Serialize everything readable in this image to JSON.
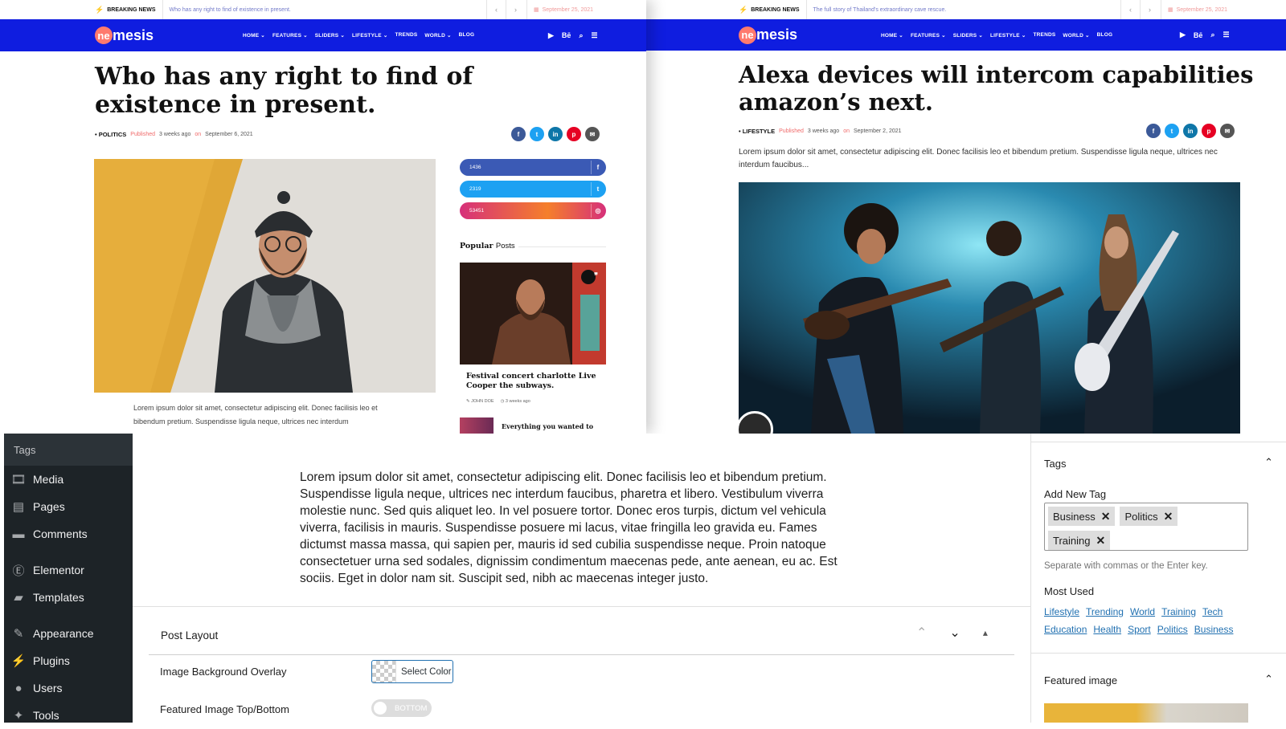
{
  "left_post": {
    "topbar": {
      "breaking_label": "BREAKING NEWS",
      "breaking_text": "Who has any right to find of existence in present.",
      "date": "September 25, 2021"
    },
    "logo": {
      "prefix": "ne",
      "suffix": "mesis"
    },
    "menu": [
      "HOME ⌄",
      "FEATURES ⌄",
      "SLIDERS ⌄",
      "LIFESTYLE ⌄",
      "TRENDS",
      "WORLD ⌄",
      "BLOG"
    ],
    "nav_icons": {
      "youtube": "▶",
      "behance": "Bē",
      "search": "⌕",
      "menu": "☰"
    },
    "title": "Who has any right to find of existence in present.",
    "meta": {
      "category": "• POLITICS",
      "published": "Published",
      "ago": "3 weeks ago",
      "on": "on",
      "date": "September 6, 2021"
    },
    "share_icons": [
      "f",
      "t",
      "in",
      "p",
      "✉"
    ],
    "excerpt": "Lorem ipsum dolor sit amet, consectetur adipiscing elit. Donec facilisis leo et bibendum pretium. Suspendisse ligula neque, ultrices nec interdum",
    "social_counts": [
      {
        "count": "1436",
        "icon": "f",
        "color": "#3b5ab5"
      },
      {
        "count": "2319",
        "icon": "t",
        "color": "#1da1f2"
      },
      {
        "count": "53451",
        "icon": "◎",
        "color": "#e4405f"
      }
    ],
    "widget": {
      "title_bold": "Popular",
      "title_rest": "Posts"
    },
    "popular_post": {
      "title": "Festival concert charlotte Live Cooper the subways.",
      "author": "JOHN DOE",
      "ago": "3 weeks ago",
      "quote_icon": "❞"
    },
    "popular_post_2": {
      "title": "Everything you wanted to"
    }
  },
  "right_post": {
    "topbar": {
      "breaking_label": "BREAKING NEWS",
      "breaking_text": "The full story of Thailand's extraordinary cave rescue.",
      "date": "September 25, 2021"
    },
    "logo": {
      "prefix": "ne",
      "suffix": "mesis"
    },
    "menu": [
      "HOME ⌄",
      "FEATURES ⌄",
      "SLIDERS ⌄",
      "LIFESTYLE ⌄",
      "TRENDS",
      "WORLD ⌄",
      "BLOG"
    ],
    "nav_icons": {
      "youtube": "▶",
      "behance": "Bē",
      "search": "⌕",
      "menu": "☰"
    },
    "title": "Alexa devices will intercom capabilities amazon’s next.",
    "meta": {
      "category": "• LIFESTYLE",
      "published": "Published",
      "ago": "3 weeks ago",
      "on": "on",
      "date": "September 2, 2021"
    },
    "share_icons": [
      "f",
      "t",
      "in",
      "p",
      "✉"
    ],
    "excerpt": "Lorem ipsum dolor sit amet, consectetur adipiscing elit. Donec facilisis leo et bibendum pretium. Suspendisse ligula neque, ultrices nec interdum faucibus..."
  },
  "wp": {
    "sidebar_top": "Tags",
    "menu": [
      {
        "label": "Media",
        "icon": "🎞"
      },
      {
        "label": "Pages",
        "icon": "▤"
      },
      {
        "label": "Comments",
        "icon": "▬"
      },
      {
        "label": "Elementor",
        "icon": "Ⓔ"
      },
      {
        "label": "Templates",
        "icon": "▰"
      },
      {
        "label": "Appearance",
        "icon": "✎"
      },
      {
        "label": "Plugins",
        "icon": "⚡"
      },
      {
        "label": "Users",
        "icon": "●"
      },
      {
        "label": "Tools",
        "icon": "✦"
      }
    ],
    "editor_text": "Lorem ipsum dolor sit amet, consectetur adipiscing elit. Donec facilisis leo et bibendum pretium. Suspendisse ligula neque, ultrices nec interdum faucibus, pharetra et libero. Vestibulum viverra molestie nunc. Sed quis aliquet leo. In vel posuere tortor. Donec eros turpis, dictum vel vehicula viverra, facilisis in mauris. Suspendisse posuere mi lacus, vitae fringilla leo gravida eu. Fames dictumst massa massa, qui sapien per, mauris id sed cubilia suspendisse neque. Proin natoque consectetuer urna sed sodales, dignissim condimentum maecenas pede, ante aenean, eu ac. Est sociis. Eget in dolor nam sit. Suscipit sed, nibh ac maecenas integer justo.",
    "post_layout": {
      "title": "Post Layout",
      "arrows": [
        "⌃",
        "⌄",
        "▴"
      ],
      "field1_label": "Image Background Overlay",
      "select_color": "Select Color",
      "field2_label": "Featured Image Top/Bottom",
      "toggle_text": "BOTTOM"
    },
    "tags_panel": {
      "title": "Tags",
      "add_new": "Add New Tag",
      "tags": [
        "Business",
        "Politics",
        "Training"
      ],
      "help": "Separate with commas or the Enter key.",
      "most_used": "Most Used",
      "most_used_links": [
        "Lifestyle",
        "Trending",
        "World",
        "Training",
        "Tech",
        "Education",
        "Health",
        "Sport",
        "Politics",
        "Business"
      ],
      "chevron": "⌃"
    },
    "featured_image": {
      "title": "Featured image",
      "chevron": "⌃"
    }
  }
}
